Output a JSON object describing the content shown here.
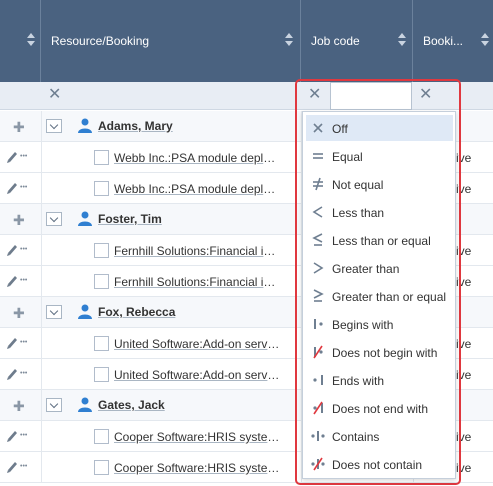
{
  "columns": {
    "resource": "Resource/Booking",
    "job_code": "Job code",
    "booking": "Booki..."
  },
  "filter": {
    "job_code_value": ""
  },
  "rows": [
    {
      "type": "parent",
      "name": "Adams, Mary"
    },
    {
      "type": "child",
      "label": "Webb Inc.:PSA module deploy...",
      "col3": "ive"
    },
    {
      "type": "child",
      "label": "Webb Inc.:PSA module deploy...",
      "col3": "ive"
    },
    {
      "type": "parent",
      "name": "Foster, Tim"
    },
    {
      "type": "child",
      "label": "Fernhill Solutions:Financial int...",
      "col3": "ive"
    },
    {
      "type": "child",
      "label": "Fernhill Solutions:Financial int...",
      "col3": "ive"
    },
    {
      "type": "parent",
      "name": "Fox, Rebecca"
    },
    {
      "type": "child",
      "label": "United Software:Add-on servic...",
      "col3": "ive"
    },
    {
      "type": "child",
      "label": "United Software:Add-on servic...",
      "col3": "ive"
    },
    {
      "type": "parent",
      "name": "Gates, Jack"
    },
    {
      "type": "child",
      "label": "Cooper Software:HRIS system...",
      "col3": "ive"
    },
    {
      "type": "child",
      "label": "Cooper Software:HRIS system...",
      "col3": "ive"
    }
  ],
  "filter_menu": {
    "selected": "Off",
    "options": [
      {
        "label": "Off",
        "icon": "x-icon"
      },
      {
        "label": "Equal",
        "icon": "equal-icon"
      },
      {
        "label": "Not equal",
        "icon": "not-equal-icon"
      },
      {
        "label": "Less than",
        "icon": "less-than-icon"
      },
      {
        "label": "Less than or equal",
        "icon": "less-than-or-equal-icon"
      },
      {
        "label": "Greater than",
        "icon": "greater-than-icon"
      },
      {
        "label": "Greater than or equal",
        "icon": "greater-than-or-equal-icon"
      },
      {
        "label": "Begins with",
        "icon": "begins-with-icon"
      },
      {
        "label": "Does not begin with",
        "icon": "does-not-begin-with-icon"
      },
      {
        "label": "Ends with",
        "icon": "ends-with-icon"
      },
      {
        "label": "Does not end with",
        "icon": "does-not-end-with-icon"
      },
      {
        "label": "Contains",
        "icon": "contains-icon"
      },
      {
        "label": "Does not contain",
        "icon": "does-not-contain-icon"
      }
    ]
  },
  "colors": {
    "header_bg": "#4a6280",
    "highlight_border": "#e0383f",
    "selected_option_bg": "#dfe9f6",
    "icon_color": "#6f7f91",
    "strike_red": "#e0383f"
  }
}
